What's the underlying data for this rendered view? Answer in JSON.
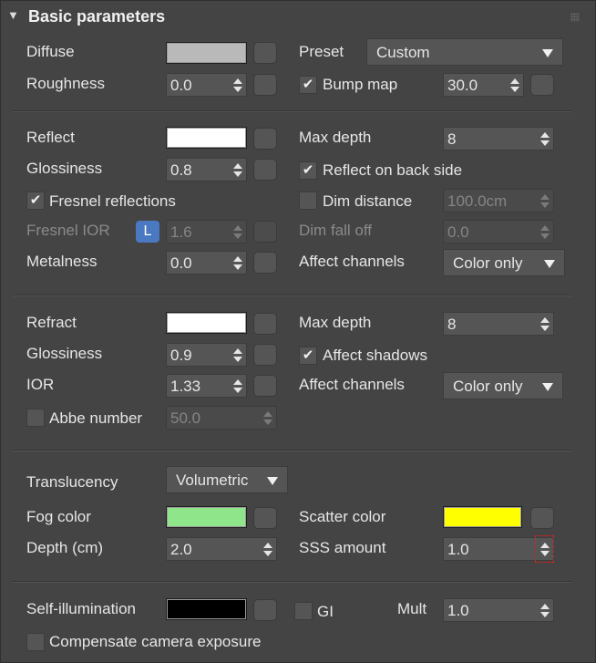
{
  "header": {
    "arrow": "▼",
    "title": "Basic parameters"
  },
  "colors": {
    "diffuse": "#b9b9b9",
    "reflect": "#ffffff",
    "refract": "#ffffff",
    "fog": "#8fe58a",
    "scatter": "#ffff00",
    "self_illum": "#000000",
    "fresnel_lock": "#4a79c2",
    "focus": "#d92020"
  },
  "diffuse": {
    "diffuse_label": "Diffuse",
    "roughness_label": "Roughness",
    "roughness": "0.0",
    "preset_label": "Preset",
    "preset": "Custom",
    "bump_label": "Bump map",
    "bump_checked": "✔",
    "bump": "30.0"
  },
  "reflect": {
    "reflect_label": "Reflect",
    "glossiness_label": "Glossiness",
    "glossiness": "0.8",
    "fresnel_label": "Fresnel reflections",
    "fresnel_checked": "✔",
    "fresnel_ior_label": "Fresnel IOR",
    "lock": "L",
    "fresnel_ior": "1.6",
    "metalness_label": "Metalness",
    "metalness": "0.0",
    "max_depth_label": "Max depth",
    "max_depth": "8",
    "back_side_label": "Reflect on back side",
    "back_side_checked": "✔",
    "dim_distance_label": "Dim distance",
    "dim_distance": "100.0cm",
    "dim_falloff_label": "Dim fall off",
    "dim_falloff": "0.0",
    "affect_label": "Affect channels",
    "affect": "Color only"
  },
  "refract": {
    "refract_label": "Refract",
    "glossiness_label": "Glossiness",
    "glossiness": "0.9",
    "ior_label": "IOR",
    "ior": "1.33",
    "abbe_label": "Abbe number",
    "abbe": "50.0",
    "max_depth_label": "Max depth",
    "max_depth": "8",
    "shadows_label": "Affect shadows",
    "shadows_checked": "✔",
    "affect_label": "Affect channels",
    "affect": "Color only"
  },
  "translucency": {
    "label": "Translucency",
    "mode": "Volumetric",
    "fog_label": "Fog color",
    "depth_label": "Depth (cm)",
    "depth": "2.0",
    "scatter_label": "Scatter color",
    "sss_label": "SSS amount",
    "sss": "1.0"
  },
  "self_illum": {
    "label": "Self-illumination",
    "gi_label": "GI",
    "mult_label": "Mult",
    "mult": "1.0",
    "compensate_label": "Compensate camera exposure"
  }
}
